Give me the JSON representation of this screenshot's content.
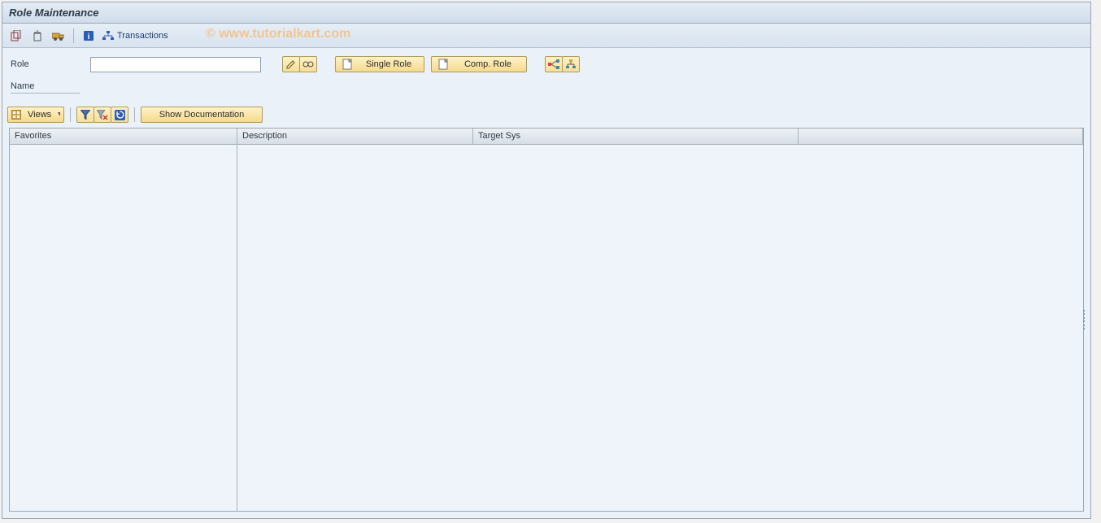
{
  "window": {
    "title": "Role Maintenance"
  },
  "appbar": {
    "transactions_label": "Transactions",
    "watermark": "© www.tutorialkart.com"
  },
  "form": {
    "role_label": "Role",
    "role_value": "",
    "name_label": "Name",
    "single_role_label": "Single Role",
    "comp_role_label": "Comp. Role"
  },
  "toolbar2": {
    "views_label": "Views",
    "show_doc_label": "Show Documentation"
  },
  "table": {
    "columns": {
      "favorites": "Favorites",
      "description": "Description",
      "target_sys": "Target Sys"
    }
  }
}
